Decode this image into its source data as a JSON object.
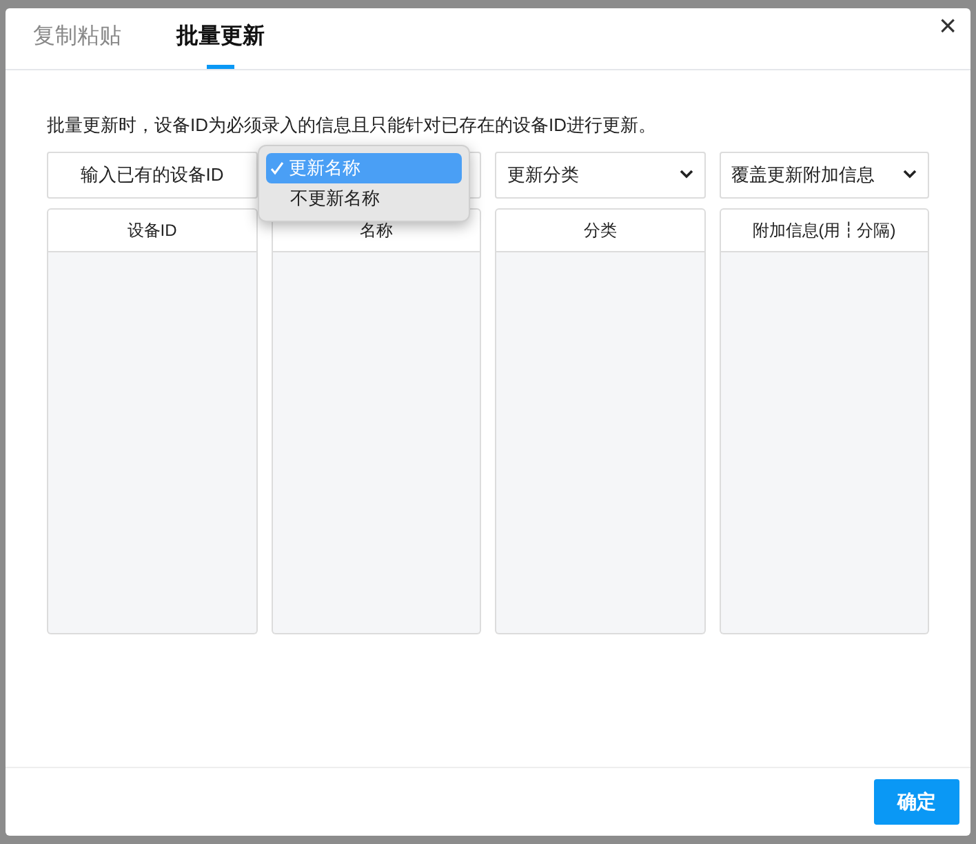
{
  "tabs": [
    {
      "label": "复制粘贴",
      "selected": false
    },
    {
      "label": "批量更新",
      "selected": true
    }
  ],
  "close": "×",
  "description": "批量更新时，设备ID为必须录入的信息且只能针对已存在的设备ID进行更新。",
  "columns": [
    {
      "kind": "label",
      "control": "输入已有的设备ID",
      "header": "设备ID"
    },
    {
      "kind": "select",
      "header": "名称",
      "menu": [
        {
          "label": "更新名称",
          "selected": true
        },
        {
          "label": "不更新名称",
          "selected": false
        }
      ]
    },
    {
      "kind": "select",
      "control": "更新分类",
      "header": "分类"
    },
    {
      "kind": "select",
      "control": "覆盖更新附加信息",
      "header": "附加信息(用┇分隔)"
    }
  ],
  "confirm_button": "确定"
}
